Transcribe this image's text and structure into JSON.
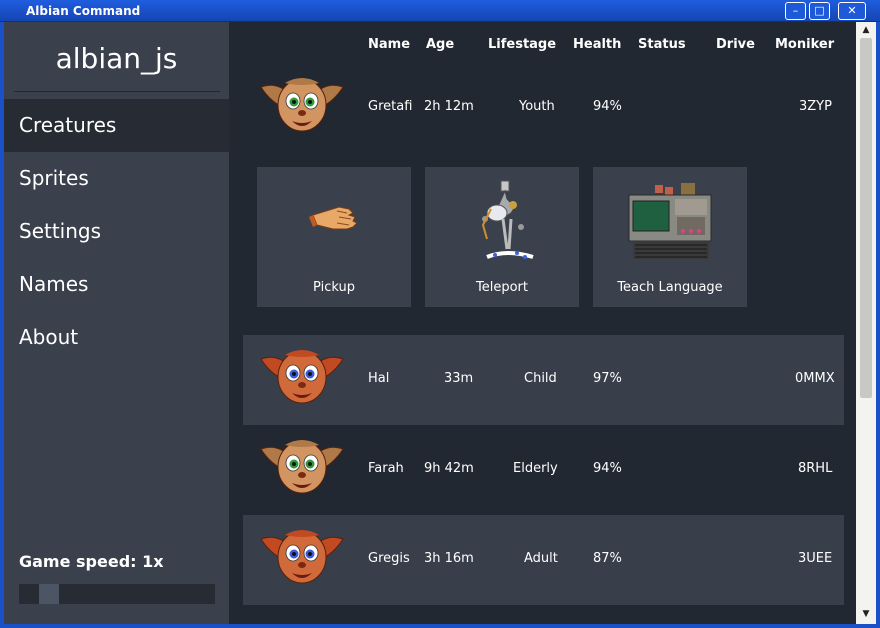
{
  "window": {
    "title": "Albian Command",
    "minimize_glyph": "–",
    "maximize_glyph": "□",
    "close_glyph": "✕"
  },
  "sidebar": {
    "app_name": "albian_js",
    "items": [
      {
        "label": "Creatures",
        "active": true
      },
      {
        "label": "Sprites"
      },
      {
        "label": "Settings"
      },
      {
        "label": "Names"
      },
      {
        "label": "About"
      }
    ],
    "speed_label": "Game speed: 1x",
    "speed_level": 0.1
  },
  "table": {
    "headers": [
      "Name",
      "Age",
      "Lifestage",
      "Health",
      "Status",
      "Drive",
      "Moniker"
    ],
    "rows": [
      {
        "name": "Gretafi",
        "age": "2h 12m",
        "lifestage": "Youth",
        "health": "94%",
        "status": "",
        "drive": "",
        "moniker": "3ZYP",
        "eyes": "green",
        "hair": "light",
        "shaded": false
      },
      {
        "name": "Hal",
        "age": "33m",
        "lifestage": "Child",
        "health": "97%",
        "status": "",
        "drive": "",
        "moniker": "0MMX",
        "eyes": "blue",
        "hair": "red",
        "shaded": true
      },
      {
        "name": "Farah",
        "age": "9h 42m",
        "lifestage": "Elderly",
        "health": "94%",
        "status": "",
        "drive": "",
        "moniker": "8RHL",
        "eyes": "green",
        "hair": "light",
        "shaded": false
      },
      {
        "name": "Gregis",
        "age": "3h 16m",
        "lifestage": "Adult",
        "health": "87%",
        "status": "",
        "drive": "",
        "moniker": "3UEE",
        "eyes": "blue",
        "hair": "red",
        "shaded": true
      }
    ]
  },
  "actions": [
    {
      "label": "Pickup",
      "icon": "hand-icon"
    },
    {
      "label": "Teleport",
      "icon": "teleporter-icon"
    },
    {
      "label": "Teach Language",
      "icon": "learning-machine-icon"
    }
  ],
  "colors": {
    "titlebar": "#1a4fc6",
    "sidebar": "#3a414c",
    "main": "#222831",
    "row_shaded": "#383f4a",
    "active_nav": "#262b34"
  },
  "scrollbar": {
    "up_glyph": "▲",
    "down_glyph": "▼"
  }
}
